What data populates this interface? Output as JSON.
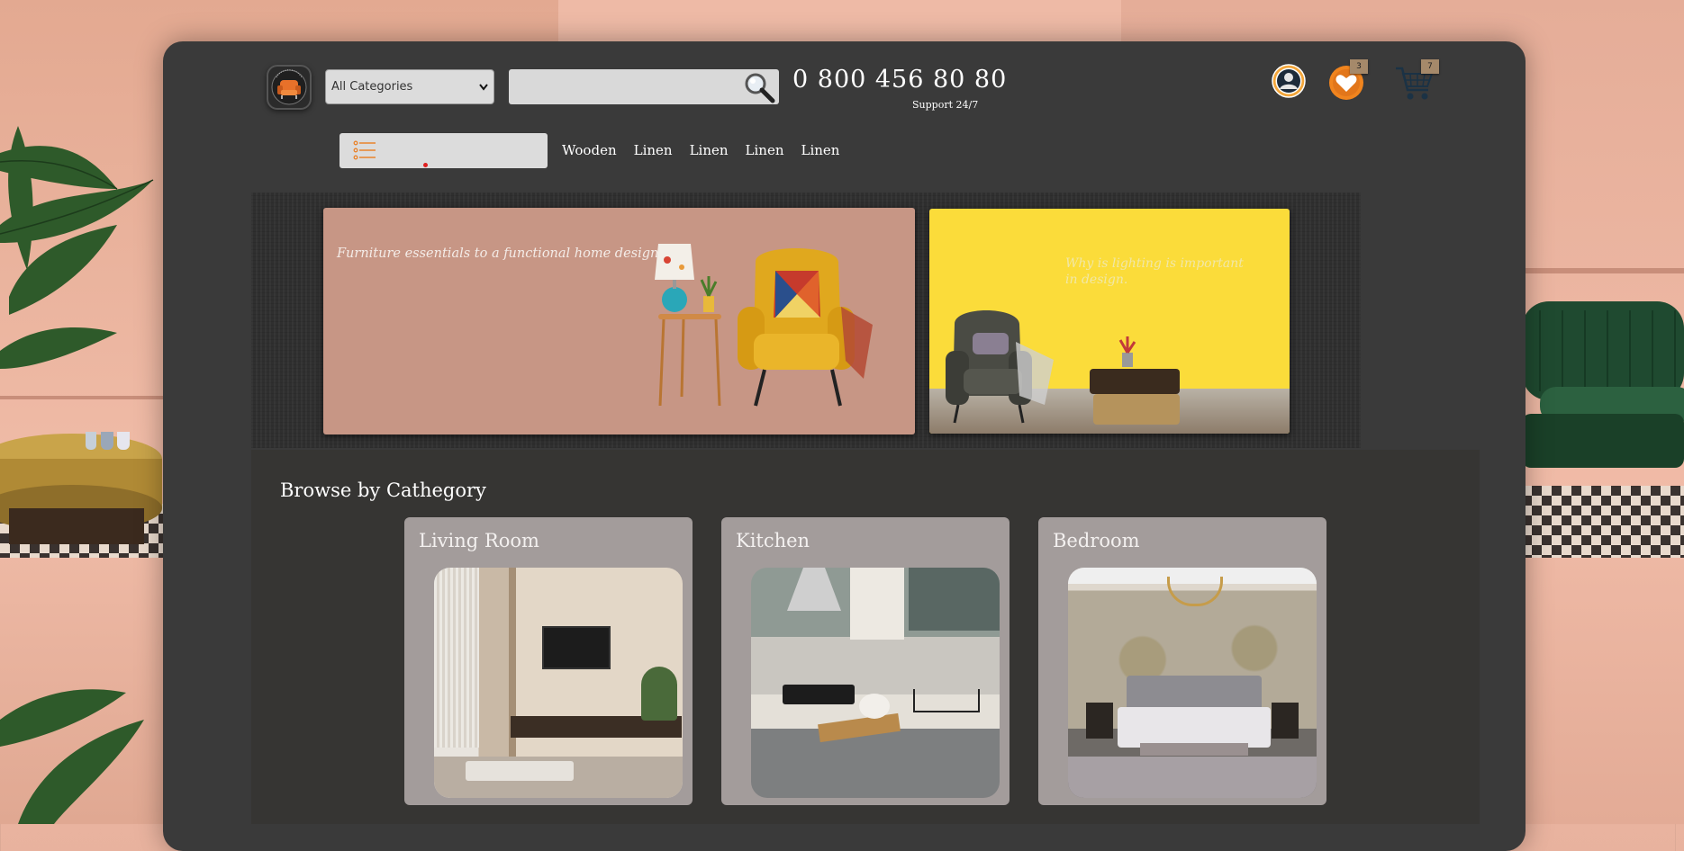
{
  "header": {
    "category_select": {
      "selected": "All Categories",
      "options": [
        "All Categories"
      ]
    },
    "search": {
      "placeholder": "",
      "value": ""
    },
    "phone": "0 800 456 80 80",
    "support": "Support 24/7",
    "wishlist_count": "3",
    "cart_count": "7"
  },
  "nav": {
    "links": [
      "Wooden",
      "Linen",
      "Linen",
      "Linen",
      "Linen"
    ]
  },
  "hero": {
    "banner1_text": "Furniture essentials to a functional home design",
    "banner2_text": "Why is lighting is important in design."
  },
  "browse": {
    "title": "Browse by Cathegory",
    "cards": [
      {
        "label": "Living Room"
      },
      {
        "label": "Kitchen"
      },
      {
        "label": "Bedroom"
      }
    ]
  },
  "colors": {
    "window_bg": "#3a3a3a",
    "accent_orange": "#f0841e",
    "banner1_bg": "#c79685",
    "banner2_bg": "#fbdc3a",
    "card_bg": "#a39c9b"
  }
}
